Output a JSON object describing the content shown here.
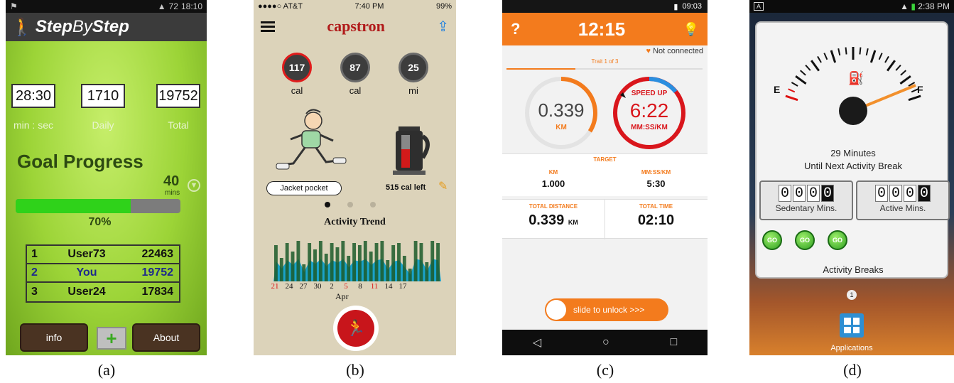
{
  "panel_a": {
    "status_time": "18:10",
    "status_battery": "72",
    "app_title_bold": "Step",
    "app_title_mid": "By",
    "app_title_end": "Step",
    "counters": [
      {
        "value": "28:30",
        "label": "min : sec"
      },
      {
        "value": "1710",
        "label": "Daily"
      },
      {
        "value": "19752",
        "label": "Total"
      }
    ],
    "goal_title": "Goal Progress",
    "goal_minutes": "40",
    "goal_minutes_unit": "mins",
    "progress_percent": 70,
    "progress_label": "70%",
    "leaderboard": [
      {
        "rank": "1",
        "name": "User73",
        "score": "22463"
      },
      {
        "rank": "2",
        "name": "You",
        "score": "19752"
      },
      {
        "rank": "3",
        "name": "User24",
        "score": "17834"
      }
    ],
    "buttons": {
      "info": "info",
      "plus": "+",
      "about": "About"
    },
    "caption": "(a)"
  },
  "panel_b": {
    "status_carrier": "●●●●○ AT&T",
    "status_time": "7:40 PM",
    "status_battery": "99%",
    "brand": "capstron",
    "stats": [
      {
        "value": "117",
        "label": "cal"
      },
      {
        "value": "87",
        "label": "cal"
      },
      {
        "value": "25",
        "label": "mi"
      }
    ],
    "chip_label": "Jacket pocket",
    "cal_left": "515 cal left",
    "trend_title": "Activity Trend",
    "trend_ticks": [
      "21",
      "24",
      "27",
      "30",
      "2",
      "5",
      "8",
      "11",
      "14",
      "17"
    ],
    "trend_tick_red": [
      "21",
      "5",
      "11"
    ],
    "trend_month": "Apr",
    "trend_bars": [
      0.85,
      0.55,
      0.9,
      0.7,
      0.95,
      0.4,
      0.9,
      0.75,
      0.95,
      0.65,
      0.9,
      0.8,
      0.95,
      0.6,
      0.9,
      0.85,
      0.95,
      0.7,
      0.9,
      0.95,
      0.5,
      0.85,
      0.9,
      0.6,
      0.3,
      0.95,
      0.9,
      0.45,
      0.95,
      0.9
    ],
    "caption": "(b)"
  },
  "panel_c": {
    "status_time": "09:03",
    "clock": "12:15",
    "help": "?",
    "connection": "Not connected",
    "trait": "Trait 1 of 3",
    "trait_progress": 0.35,
    "distance_value": "0.339",
    "distance_unit": "KM",
    "distance_ring_fraction": 0.34,
    "speed_alert": "SPEED UP",
    "pace_value": "6:22",
    "pace_unit": "MM:SS/KM",
    "target_title": "TARGET",
    "target_km_label": "KM",
    "target_km_value": "1.000",
    "target_pace_label": "MM:SS/KM",
    "target_pace_value": "5:30",
    "total_distance_label": "TOTAL DISTANCE",
    "total_distance_value": "0.339",
    "total_distance_unit": "KM",
    "total_time_label": "TOTAL TIME",
    "total_time_value": "02:10",
    "slider_label": "slide to unlock >>>",
    "caption": "(c)"
  },
  "panel_d": {
    "status_time": "2:38 PM",
    "gauge_e": "E",
    "gauge_f": "F",
    "minutes_line": "29 Minutes",
    "until_line": "Until Next Activity Break",
    "sedentary_digits": [
      "0",
      "0",
      "0",
      "0"
    ],
    "sedentary_label": "Sedentary Mins.",
    "active_digits": [
      "0",
      "0",
      "0",
      "0"
    ],
    "active_label": "Active Mins.",
    "go_label": "GO",
    "breaks_label": "Activity Breaks",
    "page_indicator": "1",
    "apps_label": "Applications",
    "caption": "(d)"
  },
  "colors": {
    "step_green": "#2fd21a",
    "capstron_red": "#b11a1a",
    "running_orange": "#f37b1d",
    "go_green": "#2fa021"
  }
}
